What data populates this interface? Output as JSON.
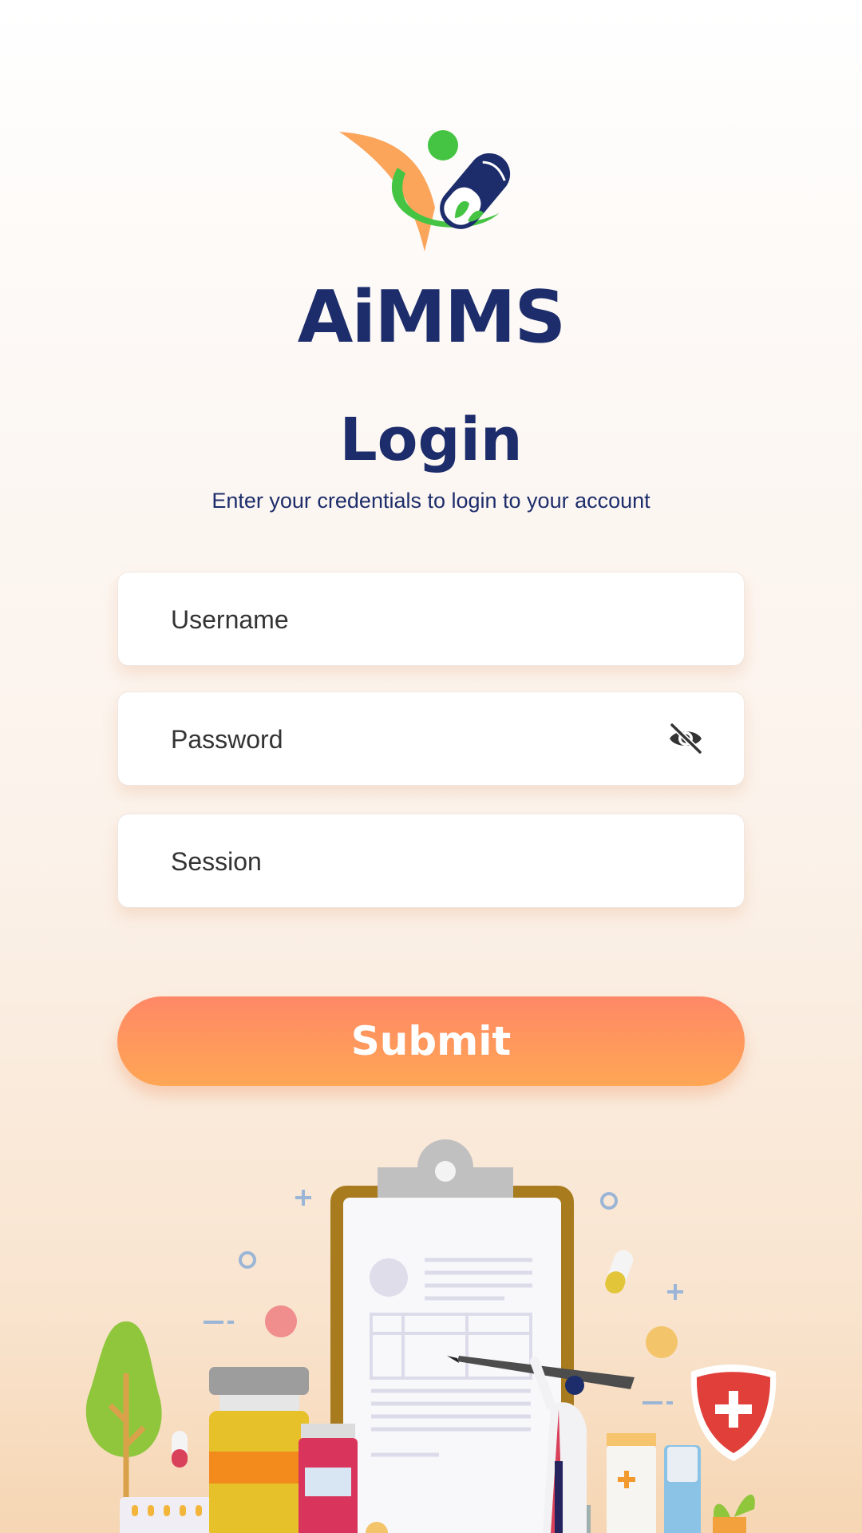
{
  "app": {
    "name": "AiMMS"
  },
  "header": {
    "title": "Login",
    "subtitle": "Enter your credentials to login to your account"
  },
  "form": {
    "username": {
      "placeholder": "Username",
      "value": ""
    },
    "password": {
      "placeholder": "Password",
      "value": "",
      "toggle_icon": "eye-off-icon"
    },
    "session": {
      "placeholder": "Session",
      "value": ""
    },
    "submit_label": "Submit"
  },
  "colors": {
    "brand_navy": "#1d2d6b",
    "accent_orange": "#ff9a5c",
    "logo_green": "#45c443"
  },
  "illustration": {
    "icons": [
      "clipboard-icon",
      "doctor-icon",
      "medicine-bottle-icon",
      "shield-cross-icon",
      "tree-icon",
      "pill-icon"
    ]
  }
}
